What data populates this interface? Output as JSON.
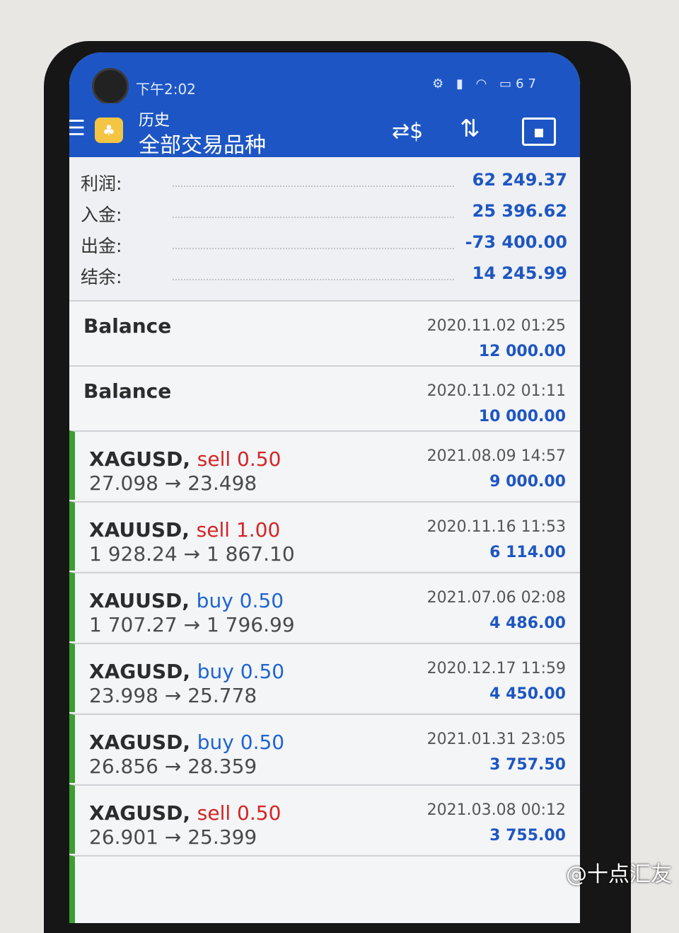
{
  "status": {
    "time": "下午2:02",
    "battery": "67"
  },
  "appbar": {
    "subtitle": "历史",
    "title": "全部交易品种",
    "menu_icon": "hamburger-icon",
    "tools": [
      "currency-exchange-icon",
      "sort-icon",
      "calendar-icon"
    ]
  },
  "summary": [
    {
      "label": "利润:",
      "value": "62 249.37"
    },
    {
      "label": "入金:",
      "value": "25 396.62"
    },
    {
      "label": "出金:",
      "value": "-73 400.00"
    },
    {
      "label": "结余:",
      "value": "14 245.99"
    }
  ],
  "balances": [
    {
      "label": "Balance",
      "date": "2020.11.02 01:25",
      "amount": "12 000.00"
    },
    {
      "label": "Balance",
      "date": "2020.11.02 01:11",
      "amount": "10 000.00"
    }
  ],
  "trades": [
    {
      "symbol": "XAGUSD,",
      "side": "sell 0.50",
      "prices": "27.098 → 23.498",
      "date": "2021.08.09 14:57",
      "profit": "9 000.00"
    },
    {
      "symbol": "XAUUSD,",
      "side": "sell 1.00",
      "prices": "1 928.24 → 1 867.10",
      "date": "2020.11.16 11:53",
      "profit": "6 114.00"
    },
    {
      "symbol": "XAUUSD,",
      "side": "buy 0.50",
      "prices": "1 707.27 → 1 796.99",
      "date": "2021.07.06 02:08",
      "profit": "4 486.00"
    },
    {
      "symbol": "XAGUSD,",
      "side": "buy 0.50",
      "prices": "23.998 → 25.778",
      "date": "2020.12.17 11:59",
      "profit": "4 450.00"
    },
    {
      "symbol": "XAGUSD,",
      "side": "buy 0.50",
      "prices": "26.856 → 28.359",
      "date": "2021.01.31 23:05",
      "profit": "3 757.50"
    },
    {
      "symbol": "XAGUSD,",
      "side": "sell 0.50",
      "prices": "26.901 → 25.399",
      "date": "2021.03.08 00:12",
      "profit": "3 755.00"
    }
  ],
  "colors": {
    "primary": "#1d56c4",
    "sell": "#d42424",
    "buy": "#1e64d2",
    "profit": "#1e56c2",
    "trade_marker": "#3e9e32"
  },
  "watermark": "@十点汇友"
}
